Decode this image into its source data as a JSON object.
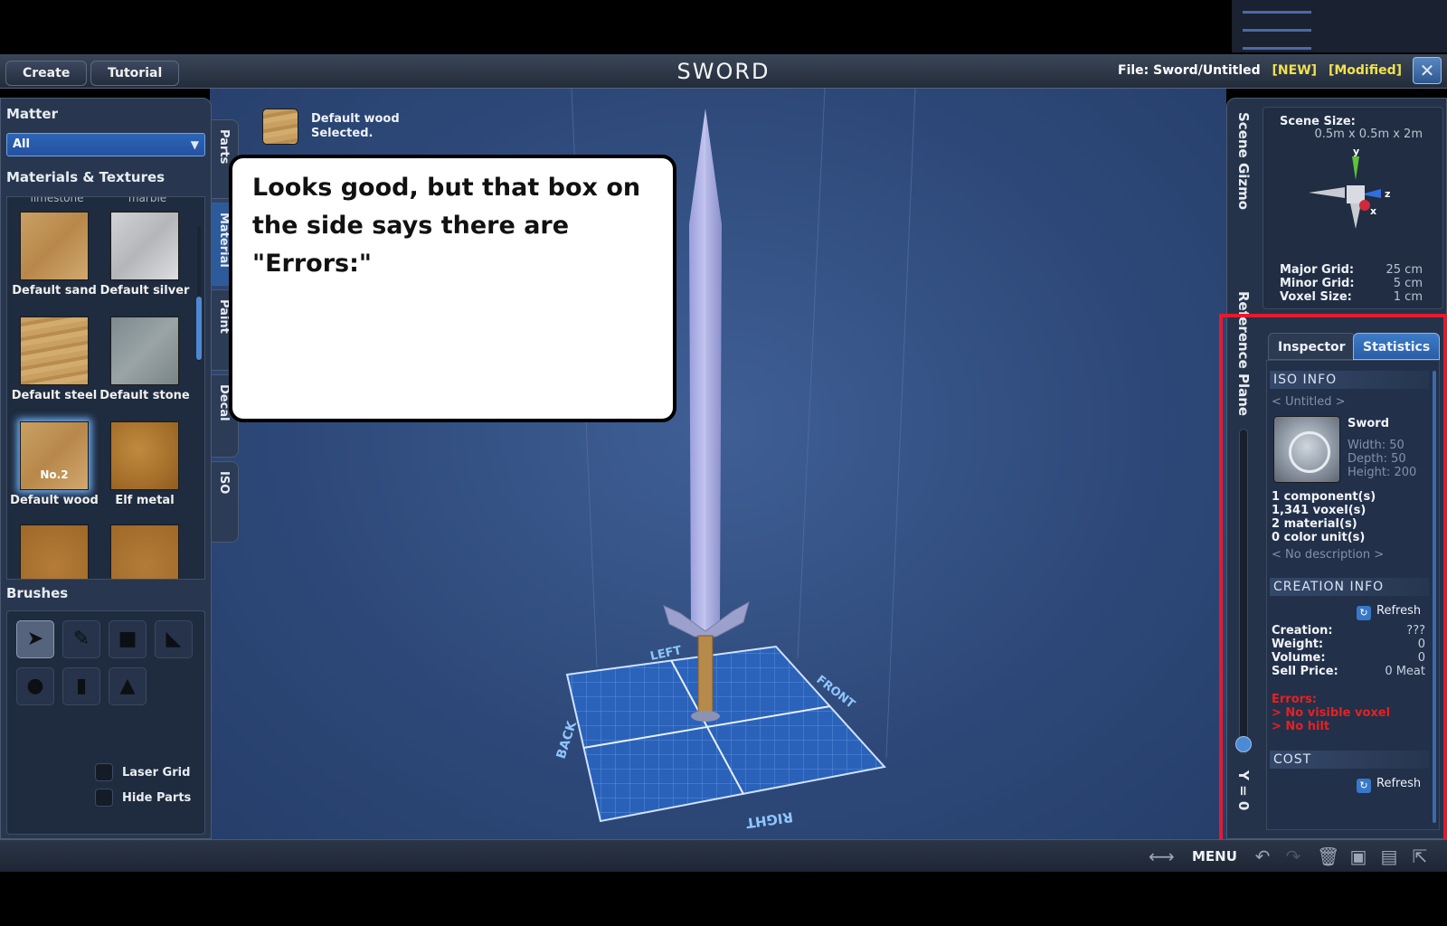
{
  "header": {
    "tabs": [
      "Create",
      "Tutorial"
    ],
    "title": "SWORD",
    "file_label": "File:",
    "file_path": "Sword/Untitled",
    "flag_new": "[NEW]",
    "flag_modified": "[Modified]",
    "close_glyph": "✕"
  },
  "left_panel": {
    "matter_label": "Matter",
    "matter_value": "All",
    "materials_label": "Materials & Textures",
    "partial_row": [
      "limestone",
      "marble"
    ],
    "materials": [
      {
        "name": "Default sand",
        "swatch": "sand"
      },
      {
        "name": "Default silver",
        "swatch": "silver"
      },
      {
        "name": "Default steel",
        "swatch": "wood"
      },
      {
        "name": "Default stone",
        "swatch": "steel"
      },
      {
        "name": "Default wood",
        "swatch": "sand",
        "badge": "No.2",
        "selected": true
      },
      {
        "name": "Elf metal",
        "swatch": "elf"
      }
    ],
    "brushes_label": "Brushes",
    "laser_grid": "Laser Grid",
    "hide_parts": "Hide Parts"
  },
  "vertical_tabs": [
    "Parts",
    "Material",
    "Paint",
    "Decal",
    "ISO"
  ],
  "selected_material": {
    "line1": "Default wood",
    "line2": "Selected."
  },
  "callout": {
    "text": "Looks good, but that box on the side says there are \"Errors:\""
  },
  "viewport": {
    "axis_labels": {
      "left": "LEFT",
      "front": "FRONT",
      "back": "BACK",
      "right": "RIGHT"
    }
  },
  "right_panel": {
    "scene_gizmo_label": "Scene Gizmo",
    "reference_plane_label": "Reference Plane",
    "y_readout": "Y = 0",
    "scene_size_label": "Scene Size:",
    "scene_size_value": "0.5m x 0.5m x 2m",
    "gizmo_axes": {
      "y": "y",
      "z": "z",
      "x": "x"
    },
    "major_grid_label": "Major Grid:",
    "major_grid_value": "25 cm",
    "minor_grid_label": "Minor Grid:",
    "minor_grid_value": "5 cm",
    "voxel_size_label": "Voxel Size:",
    "voxel_size_value": "1 cm",
    "tabs": [
      "Inspector",
      "Statistics"
    ],
    "iso_info_title": "ISO INFO",
    "iso_name": "< Untitled >",
    "iso_type": "Sword",
    "width": "Width: 50",
    "depth": "Depth: 50",
    "height": "Height: 200",
    "components": "1 component(s)",
    "voxels": "1,341 voxel(s)",
    "materials": "2 material(s)",
    "color_units": "0 color unit(s)",
    "description": "< No description >",
    "creation_info_title": "CREATION INFO",
    "refresh": "Refresh",
    "creation_label": "Creation:",
    "creation_value": "???",
    "weight_label": "Weight:",
    "weight_value": "0",
    "volume_label": "Volume:",
    "volume_value": "0",
    "sell_price_label": "Sell Price:",
    "sell_price_value": "0 Meat",
    "errors_label": "Errors:",
    "error_1": "> No visible voxel",
    "error_2": "> No hilt",
    "cost_title": "COST",
    "cost_refresh": "Refresh"
  },
  "bottom_bar": {
    "menu_label": "MENU"
  },
  "colors": {
    "accent": "#2d5a9a",
    "error": "#e82020",
    "highlight_box": "#e8192c",
    "flag_yellow": "#f3e24c"
  }
}
